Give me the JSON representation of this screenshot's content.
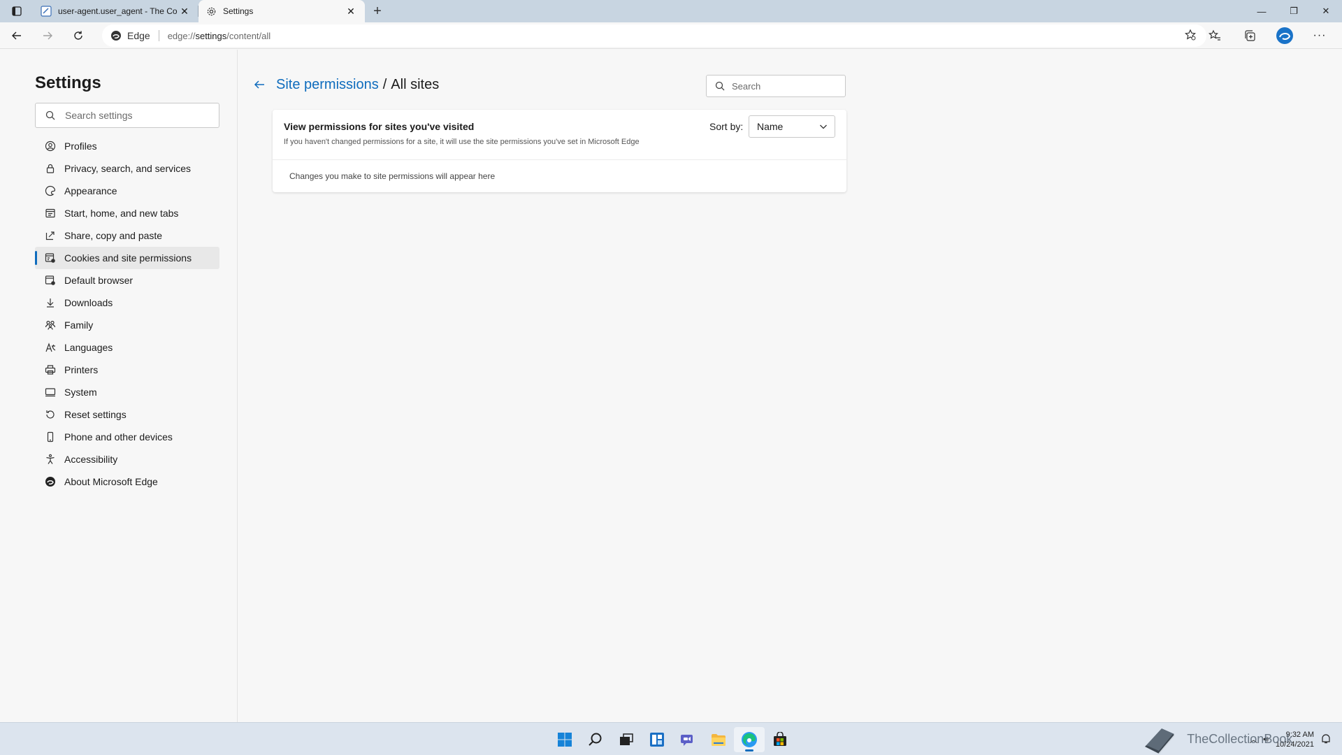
{
  "tabs": [
    {
      "title": "user-agent.user_agent - The Colle",
      "active": false
    },
    {
      "title": "Settings",
      "active": true
    }
  ],
  "toolbar": {
    "brand_label": "Edge",
    "url_prefix": "edge://",
    "url_host": "settings",
    "url_path": "/content/all"
  },
  "sidebar": {
    "title": "Settings",
    "search_placeholder": "Search settings",
    "items": [
      {
        "label": "Profiles",
        "icon": "profile-icon"
      },
      {
        "label": "Privacy, search, and services",
        "icon": "lock-icon"
      },
      {
        "label": "Appearance",
        "icon": "appearance-icon"
      },
      {
        "label": "Start, home, and new tabs",
        "icon": "home-tabs-icon"
      },
      {
        "label": "Share, copy and paste",
        "icon": "share-icon"
      },
      {
        "label": "Cookies and site permissions",
        "icon": "cookies-icon",
        "selected": true
      },
      {
        "label": "Default browser",
        "icon": "default-browser-icon"
      },
      {
        "label": "Downloads",
        "icon": "download-icon"
      },
      {
        "label": "Family",
        "icon": "family-icon"
      },
      {
        "label": "Languages",
        "icon": "languages-icon"
      },
      {
        "label": "Printers",
        "icon": "printer-icon"
      },
      {
        "label": "System",
        "icon": "system-icon"
      },
      {
        "label": "Reset settings",
        "icon": "reset-icon"
      },
      {
        "label": "Phone and other devices",
        "icon": "phone-icon"
      },
      {
        "label": "Accessibility",
        "icon": "accessibility-icon"
      },
      {
        "label": "About Microsoft Edge",
        "icon": "edge-icon"
      }
    ]
  },
  "main": {
    "breadcrumb_link": "Site permissions",
    "breadcrumb_sep": "/",
    "breadcrumb_current": "All sites",
    "search_placeholder": "Search",
    "card": {
      "title": "View permissions for sites you've visited",
      "subtitle": "If you haven't changed permissions for a site, it will use the site permissions you've set in Microsoft Edge",
      "sort_label": "Sort by:",
      "sort_value": "Name",
      "empty_text": "Changes you make to site permissions will appear here"
    }
  },
  "taskbar": {
    "watermark": "TheCollectionBook",
    "time": "9:32 AM",
    "date": "10/24/2021"
  },
  "colors": {
    "accent": "#0f6cbd",
    "tabstrip": "#c8d5e1",
    "background": "#f7f7f7"
  }
}
